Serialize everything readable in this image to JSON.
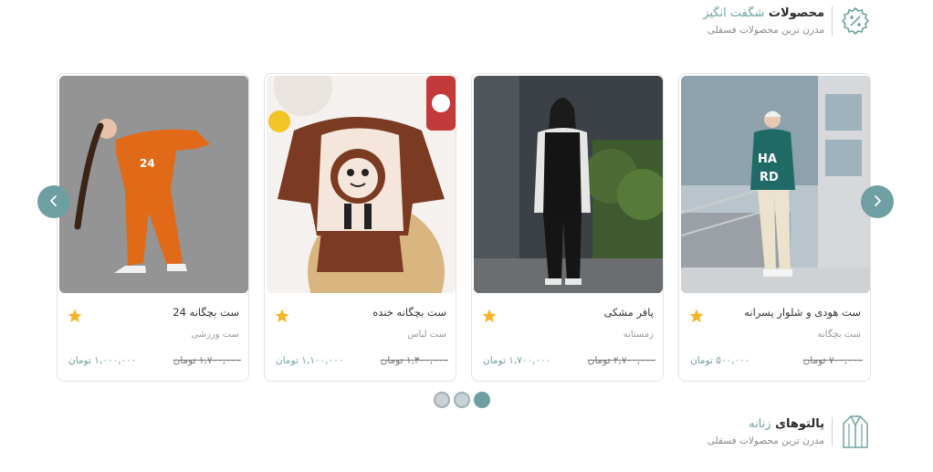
{
  "header_top": {
    "title": "محصولات",
    "title_accent": "شگفت انگیز",
    "subtitle": "مدرن ترین محصولات فسقلی",
    "icon": "discount-badge-icon"
  },
  "carousel": {
    "products": [
      {
        "name": "ست هودی و شلوار پسرانه",
        "category": "ست بچگانه",
        "price": "۵۰۰,۰۰۰ تومان",
        "old_price": "۷۰۰,۰۰۰ تومان"
      },
      {
        "name": "پافر مشکی",
        "category": "زمستانه",
        "price": "۱,۷۰۰,۰۰۰ تومان",
        "old_price": "۲,۷۰۰,۰۰۰ تومان"
      },
      {
        "name": "ست بچگانه خنده",
        "category": "ست لباس",
        "price": "۱,۱۰۰,۰۰۰ تومان",
        "old_price": "۱,۳۰۰,۰۰۰ تومان"
      },
      {
        "name": "ست بچگانه 24",
        "category": "ست ورزشی",
        "price": "۱,۰۰۰,۰۰۰ تومان",
        "old_price": "۱,۷۰۰,۰۰۰ تومان"
      }
    ],
    "prev_icon": "chevron-left-icon",
    "next_icon": "chevron-right-icon",
    "page_count": 3,
    "active_page": 3
  },
  "header_bottom": {
    "title": "پالتوهای",
    "title_accent": "زنانه",
    "subtitle": "مدرن ترین محصولات فسقلی",
    "icon": "coat-icon"
  },
  "colors": {
    "accent": "#6da3a1",
    "nav_button": "#6e9fa3",
    "star": "#f5b52a",
    "dot_inactive": "#c9d2d6"
  }
}
